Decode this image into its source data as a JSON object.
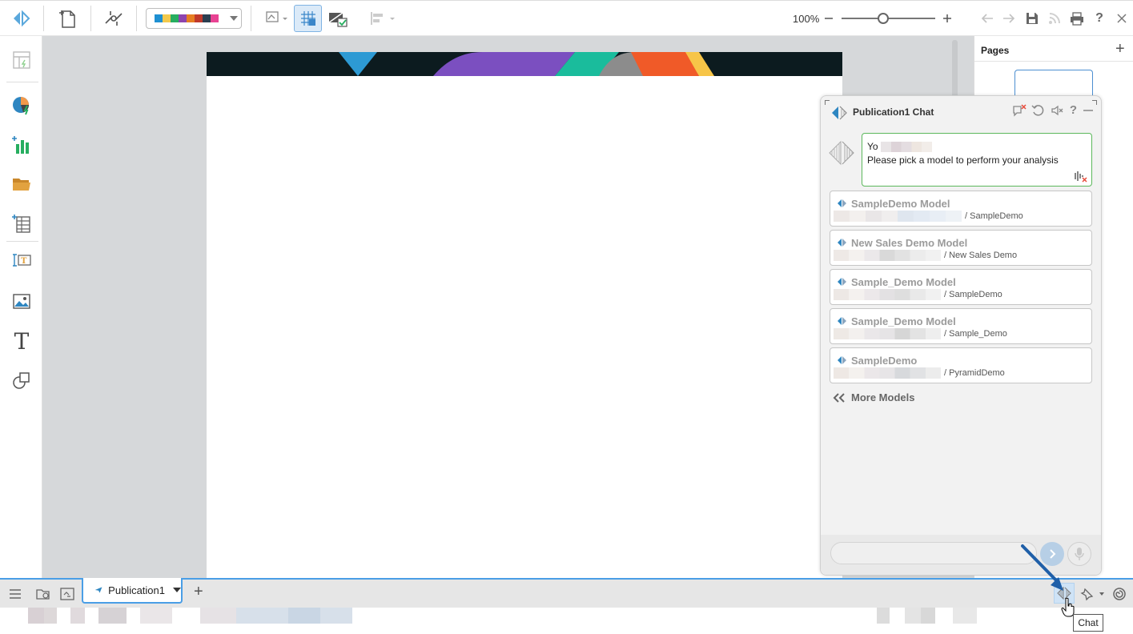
{
  "toolbar": {
    "zoom_label": "100%",
    "zoom_value_percent": 100,
    "palette_colors": [
      "#1e90d2",
      "#f2c94c",
      "#27ae60",
      "#8e44ad",
      "#e67e22",
      "#c0392b",
      "#2c3e50",
      "#7f8c8d",
      "#e84393",
      "#00b894"
    ]
  },
  "pages_panel": {
    "title": "Pages",
    "add_symbol": "+"
  },
  "chat": {
    "title": "Publication1 Chat",
    "greeting": "Yo",
    "prompt": "Please pick a model to perform your analysis",
    "models": [
      {
        "name": "SampleDemo Model",
        "path": "/ SampleDemo"
      },
      {
        "name": "New Sales Demo Model",
        "path": "/ New Sales Demo"
      },
      {
        "name": "Sample_Demo Model",
        "path": "/ SampleDemo"
      },
      {
        "name": "Sample_Demo Model",
        "path": "/ Sample_Demo"
      },
      {
        "name": "SampleDemo",
        "path": "/ PyramidDemo"
      }
    ],
    "more_models": "More Models"
  },
  "bottom_bar": {
    "tab_label": "Publication1",
    "add_symbol": "+"
  },
  "tooltip": {
    "text": "Chat"
  },
  "colors": {
    "accent": "#4a9ee6",
    "bubble_border": "#5cb85c",
    "banner": "#0c1b1f"
  }
}
